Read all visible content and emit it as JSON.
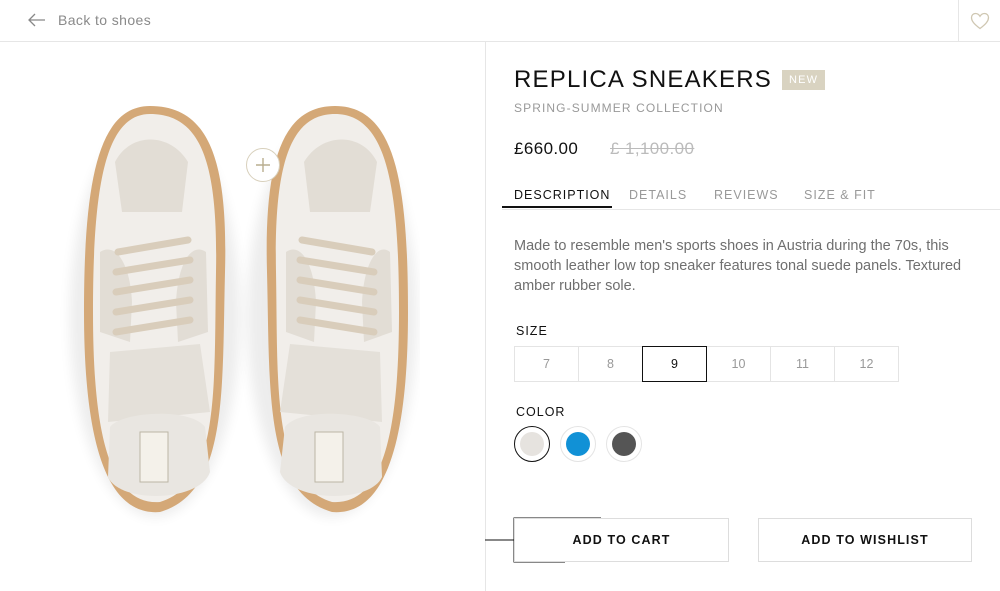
{
  "nav": {
    "back_label": "Back to shoes"
  },
  "product": {
    "title": "REPLICA SNEAKERS",
    "badge": "NEW",
    "collection": "SPRING-SUMMER COLLECTION",
    "price": "£660.00",
    "old_price": "£ 1,100.00"
  },
  "tabs": [
    {
      "label": "DESCRIPTION",
      "active": true
    },
    {
      "label": "DETAILS",
      "active": false
    },
    {
      "label": "REVIEWS",
      "active": false
    },
    {
      "label": "SIZE & FIT",
      "active": false
    }
  ],
  "description": "Made to resemble men's sports shoes in Austria during the 70s, this smooth leather low top sneaker features tonal suede panels. Textured amber rubber sole.",
  "size_section": {
    "label": "SIZE",
    "options": [
      "7",
      "8",
      "9",
      "10",
      "11",
      "12"
    ],
    "selected": "9"
  },
  "color_section": {
    "label": "COLOR",
    "options": [
      {
        "name": "off-white",
        "hex": "#e6e3df",
        "selected": true
      },
      {
        "name": "blue",
        "hex": "#1191d6",
        "selected": false
      },
      {
        "name": "dark-grey",
        "hex": "#555555",
        "selected": false
      }
    ]
  },
  "actions": {
    "add_to_cart": "ADD TO CART",
    "add_to_wishlist": "ADD TO WISHLIST"
  },
  "icons": {
    "back": "arrow-left-icon",
    "wishlist": "heart-icon",
    "zoom": "plus-icon"
  },
  "colors": {
    "accent_badge": "#d9d3c1",
    "text_primary": "#111111",
    "text_muted": "#999999"
  }
}
